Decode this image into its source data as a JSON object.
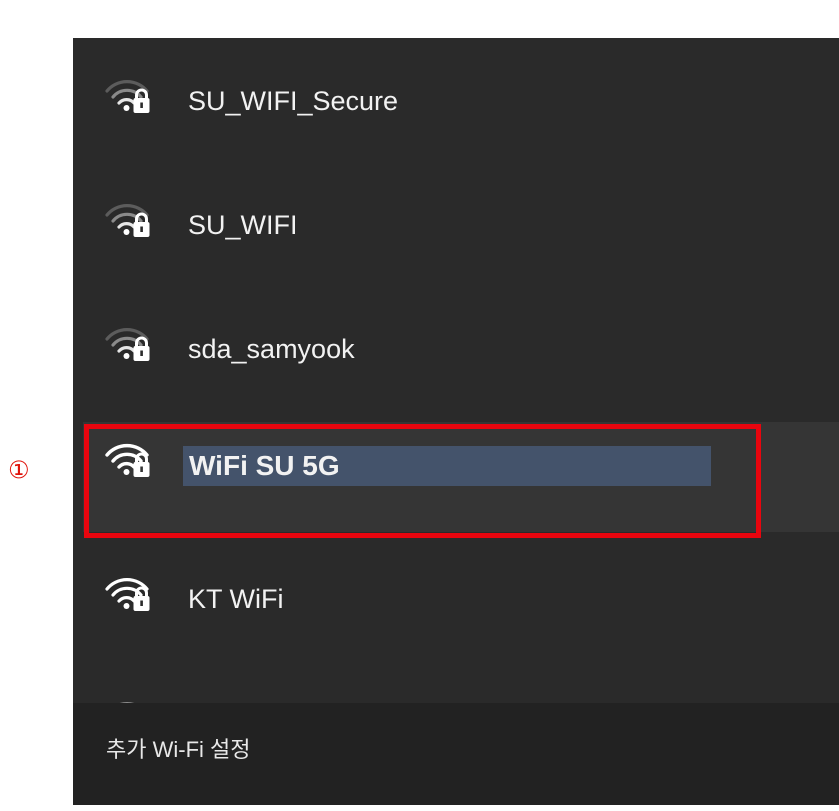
{
  "annotation": {
    "marker": "①"
  },
  "networks": [
    {
      "name": "SU_WIFI_Secure",
      "icon": "wifi-locked-icon",
      "selected": false
    },
    {
      "name": "SU_WIFI",
      "icon": "wifi-locked-icon",
      "selected": false
    },
    {
      "name": "sda_samyook",
      "icon": "wifi-locked-icon",
      "selected": false
    },
    {
      "name": "WiFi SU 5G",
      "icon": "wifi-locked-icon",
      "selected": true
    },
    {
      "name": "KT WiFi",
      "icon": "wifi-locked-icon",
      "selected": false
    }
  ],
  "footer": {
    "more_wifi_settings": "추가 Wi-Fi 설정"
  },
  "colors": {
    "panel_background": "#2a2a2a",
    "selected_background": "#353535",
    "text_highlight": "#44536b",
    "annotation_red": "#e8050e"
  }
}
